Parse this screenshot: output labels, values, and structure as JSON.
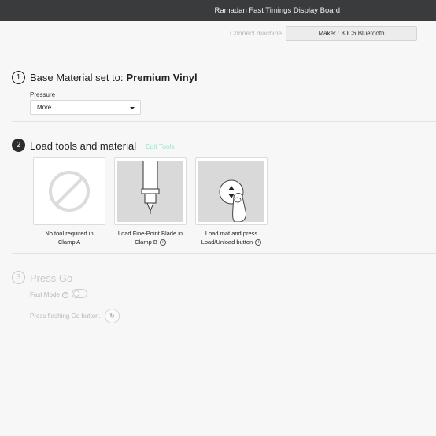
{
  "header": {
    "title": "Ramadan Fast Timings Display Board"
  },
  "connection": {
    "label": "Connect machine",
    "machine": "Maker : 30C6 Bluetooth"
  },
  "step1": {
    "number": "1",
    "title_prefix": "Base Material set to:",
    "material": "Premium Vinyl",
    "pressure_label": "Pressure",
    "pressure_value": "More"
  },
  "step2": {
    "number": "2",
    "title": "Load tools and material",
    "edit_link": "Edit Tools",
    "cards": [
      {
        "icon": "no-tool-icon",
        "line1": "No tool required in",
        "line2": "Clamp A",
        "info": false
      },
      {
        "icon": "fine-point-blade-icon",
        "line1": "Load Fine-Point Blade in",
        "line2": "Clamp B",
        "info": true
      },
      {
        "icon": "press-load-button-icon",
        "line1": "Load mat and press",
        "line2": "Load/Unload button",
        "info": true
      }
    ]
  },
  "step3": {
    "number": "3",
    "title": "Press Go",
    "fast_mode_label": "Fast Mode",
    "fast_mode_on": false,
    "go_label": "Press flashing Go button."
  },
  "colors": {
    "topbar": "#3a3b3d",
    "accent_link": "#a9dccb",
    "disabled_text": "#c9c9c9"
  }
}
